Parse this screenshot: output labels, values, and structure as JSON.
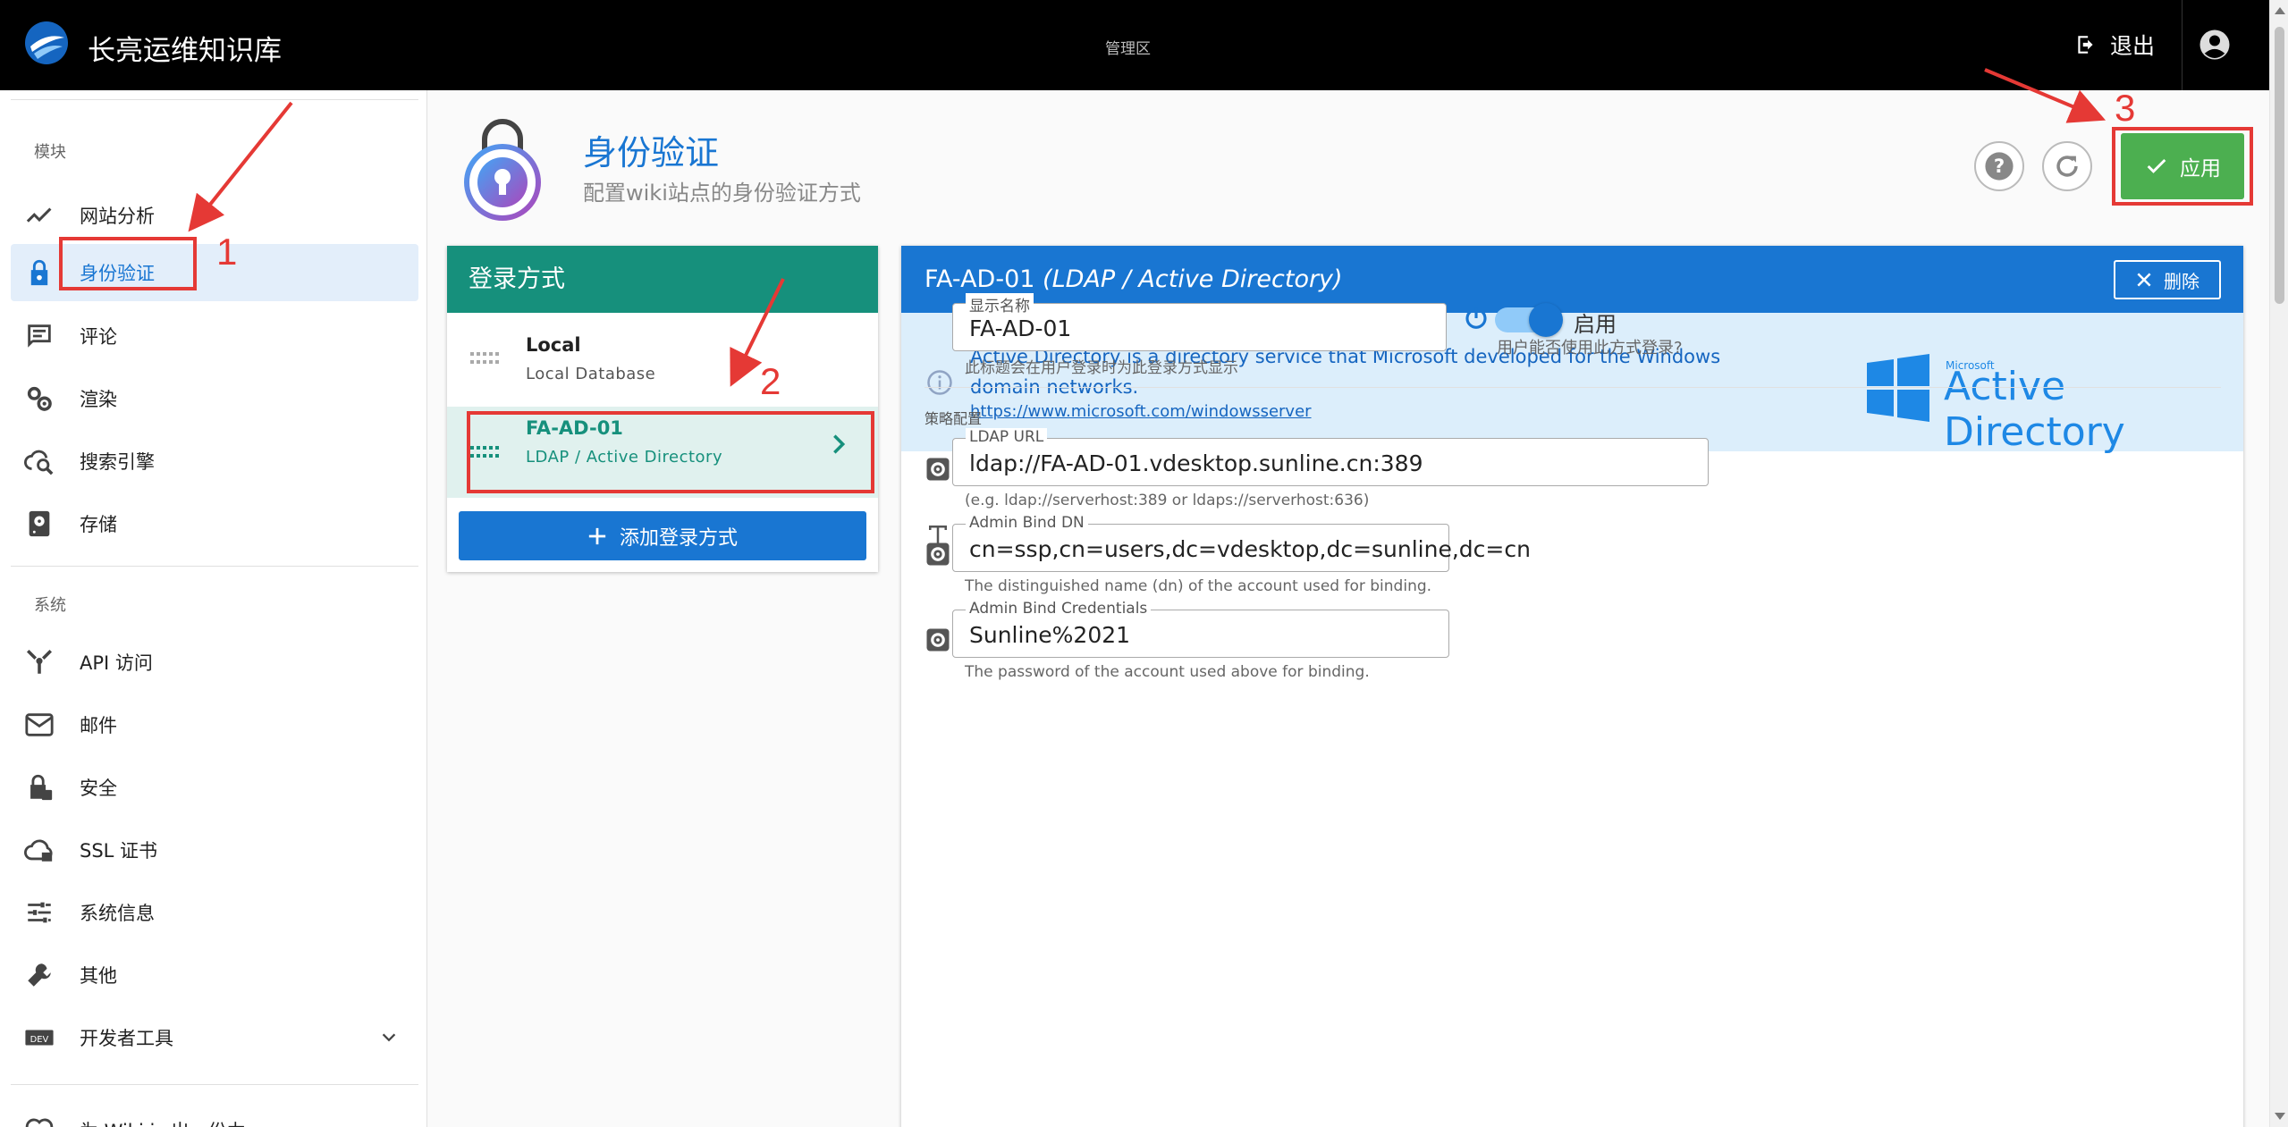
{
  "topbar": {
    "brand": "长亮运维知识库",
    "center": "管理区",
    "logout_label": "退出"
  },
  "sidebar": {
    "section_modules": "模块",
    "section_system": "系统",
    "items": [
      {
        "label": "网站分析",
        "icon": "chart-line-icon"
      },
      {
        "label": "身份验证",
        "icon": "lock-icon",
        "active": true
      },
      {
        "label": "评论",
        "icon": "comment-icon"
      },
      {
        "label": "渲染",
        "icon": "cogs-icon"
      },
      {
        "label": "搜索引擎",
        "icon": "search-cloud-icon"
      },
      {
        "label": "存储",
        "icon": "harddisk-icon"
      },
      {
        "label": "API 访问",
        "icon": "api-icon"
      },
      {
        "label": "邮件",
        "icon": "mail-icon"
      },
      {
        "label": "安全",
        "icon": "shield-lock-icon"
      },
      {
        "label": "SSL 证书",
        "icon": "cloud-lock-icon"
      },
      {
        "label": "系统信息",
        "icon": "sliders-icon"
      },
      {
        "label": "其他",
        "icon": "wrench-icon"
      },
      {
        "label": "开发者工具",
        "icon": "dev-icon"
      },
      {
        "label": "为 Wiki.js 出一份力",
        "icon": "heart-icon"
      }
    ]
  },
  "page": {
    "title": "身份验证",
    "subtitle": "配置wiki站点的身份验证方式",
    "apply_label": "应用"
  },
  "login_methods": {
    "header": "登录方式",
    "items": [
      {
        "title": "Local",
        "subtitle": "Local Database"
      },
      {
        "title": "FA-AD-01",
        "subtitle": "LDAP / Active Directory",
        "active": true
      }
    ],
    "add_label": "添加登录方式"
  },
  "detail": {
    "header_name": "FA-AD-01",
    "header_type": "(LDAP / Active Directory)",
    "delete_label": "删除",
    "info_text": "Active Directory is a directory service that Microsoft developed for the Windows domain networks.",
    "info_link": "https://www.microsoft.com/windowsserver",
    "logo_small": "Microsoft",
    "logo_text": "Active Directory",
    "display_name": {
      "label": "显示名称",
      "value": "FA-AD-01",
      "hint": "此标题会在用户登录时为此登录方式显示"
    },
    "enabled": {
      "label": "启用",
      "hint": "用户能否使用此方式登录?",
      "value": true
    },
    "strategy_section": "策略配置",
    "ldap_url": {
      "label": "LDAP URL",
      "value": "ldap://FA-AD-01.vdesktop.sunline.cn:389",
      "hint": "(e.g. ldap://serverhost:389 or ldaps://serverhost:636)"
    },
    "bind_dn": {
      "label": "Admin Bind DN",
      "value": "cn=ssp,cn=users,dc=vdesktop,dc=sunline,dc=cn",
      "hint": "The distinguished name (dn) of the account used for binding."
    },
    "bind_cred": {
      "label": "Admin Bind Credentials",
      "value": "Sunline%2021",
      "hint": "The password of the account used above for binding."
    }
  },
  "annotations": {
    "label1": "1",
    "label2": "2",
    "label3": "3",
    "color": "#e53935"
  },
  "colors": {
    "primary": "#1976d2",
    "teal": "#16907c",
    "success": "#4caf50"
  }
}
